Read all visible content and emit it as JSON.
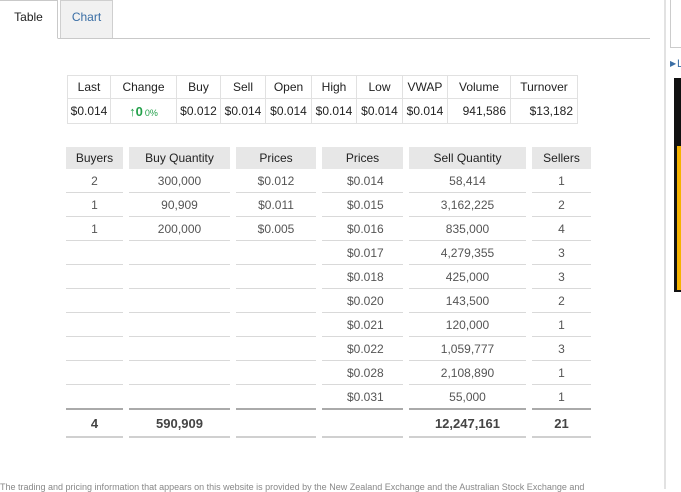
{
  "tabs": [
    {
      "label": "Table",
      "active": true
    },
    {
      "label": "Chart",
      "active": false
    }
  ],
  "quote": {
    "headers": [
      "Last",
      "Change",
      "Buy",
      "Sell",
      "Open",
      "High",
      "Low",
      "VWAP",
      "Volume",
      "Turnover"
    ],
    "values": {
      "last": "$0.014",
      "change": "0",
      "change_pct": "0%",
      "buy": "$0.012",
      "sell": "$0.014",
      "open": "$0.014",
      "high": "$0.014",
      "low": "$0.014",
      "vwap": "$0.014",
      "volume": "941,586",
      "turnover": "$13,182"
    }
  },
  "depth": {
    "headers": [
      "Buyers",
      "Buy Quantity",
      "Prices",
      "Prices",
      "Sell Quantity",
      "Sellers"
    ],
    "rows": [
      {
        "buyers": "2",
        "buy_qty": "300,000",
        "buy_price": "$0.012",
        "sell_price": "$0.014",
        "sell_qty": "58,414",
        "sellers": "1"
      },
      {
        "buyers": "1",
        "buy_qty": "90,909",
        "buy_price": "$0.011",
        "sell_price": "$0.015",
        "sell_qty": "3,162,225",
        "sellers": "2"
      },
      {
        "buyers": "1",
        "buy_qty": "200,000",
        "buy_price": "$0.005",
        "sell_price": "$0.016",
        "sell_qty": "835,000",
        "sellers": "4"
      },
      {
        "buyers": "",
        "buy_qty": "",
        "buy_price": "",
        "sell_price": "$0.017",
        "sell_qty": "4,279,355",
        "sellers": "3"
      },
      {
        "buyers": "",
        "buy_qty": "",
        "buy_price": "",
        "sell_price": "$0.018",
        "sell_qty": "425,000",
        "sellers": "3"
      },
      {
        "buyers": "",
        "buy_qty": "",
        "buy_price": "",
        "sell_price": "$0.020",
        "sell_qty": "143,500",
        "sellers": "2"
      },
      {
        "buyers": "",
        "buy_qty": "",
        "buy_price": "",
        "sell_price": "$0.021",
        "sell_qty": "120,000",
        "sellers": "1"
      },
      {
        "buyers": "",
        "buy_qty": "",
        "buy_price": "",
        "sell_price": "$0.022",
        "sell_qty": "1,059,777",
        "sellers": "3"
      },
      {
        "buyers": "",
        "buy_qty": "",
        "buy_price": "",
        "sell_price": "$0.028",
        "sell_qty": "2,108,890",
        "sellers": "1"
      },
      {
        "buyers": "",
        "buy_qty": "",
        "buy_price": "",
        "sell_price": "$0.031",
        "sell_qty": "55,000",
        "sellers": "1"
      }
    ],
    "totals": {
      "buyers": "4",
      "buy_qty": "590,909",
      "sell_qty": "12,247,161",
      "sellers": "21"
    }
  },
  "side_link": "L",
  "footer_text": "The trading and pricing information that appears on this website is provided by the New Zealand Exchange and the Australian Stock Exchange and",
  "colors": {
    "up": "#23a04a",
    "tab_link": "#3a6ea5",
    "header_bg": "#e7e7e7"
  },
  "icons": {
    "change_direction": "arrow-up-icon",
    "side_arrow": "caret-right-icon"
  }
}
